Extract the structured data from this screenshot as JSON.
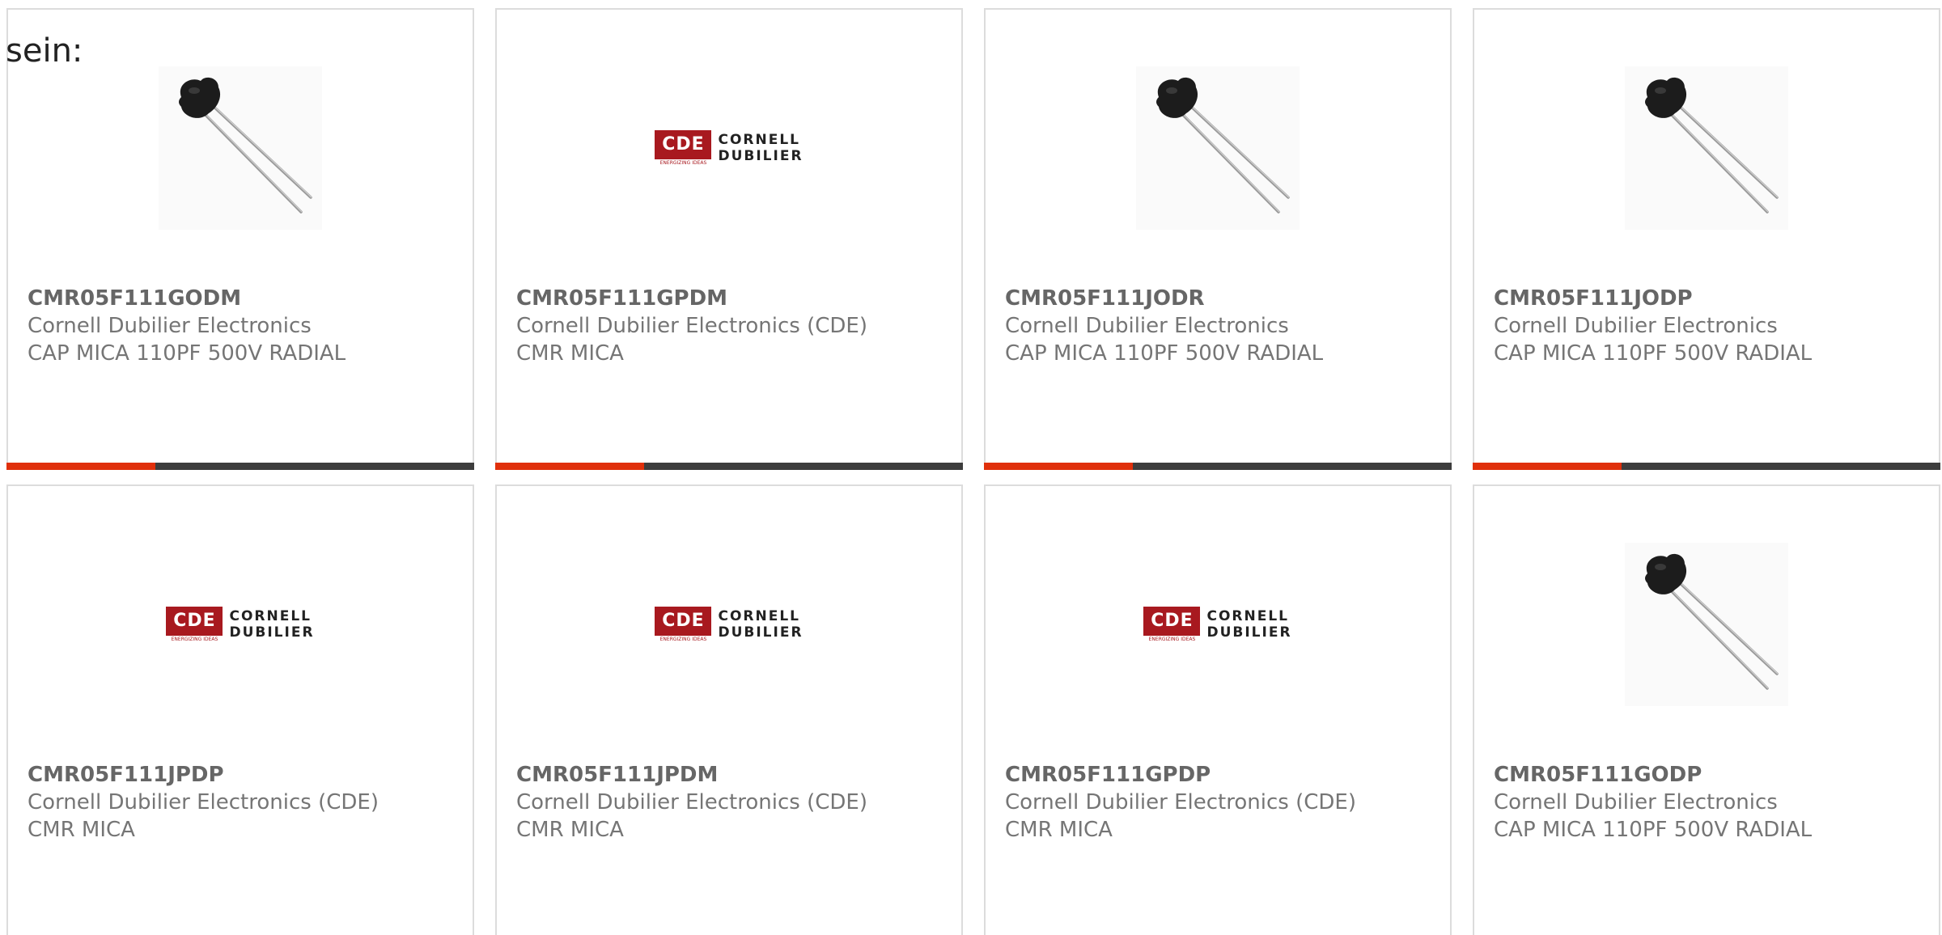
{
  "intro_text": "sein:",
  "colors": {
    "accent_bar": "#e0300b",
    "dark_bar": "#3d3d3d",
    "cde_red": "#a8191f"
  },
  "cards": [
    {
      "part": "CMR05F111GODM",
      "manufacturer": "Cornell Dubilier Electronics",
      "description": "CAP MICA 110PF 500V RADIAL",
      "image": "capacitor-photo"
    },
    {
      "part": "CMR05F111GPDM",
      "manufacturer": "Cornell Dubilier Electronics (CDE)",
      "description": "CMR MICA",
      "image": "cde-logo"
    },
    {
      "part": "CMR05F111JODR",
      "manufacturer": "Cornell Dubilier Electronics",
      "description": "CAP MICA 110PF 500V RADIAL",
      "image": "capacitor-photo"
    },
    {
      "part": "CMR05F111JODP",
      "manufacturer": "Cornell Dubilier Electronics",
      "description": "CAP MICA 110PF 500V RADIAL",
      "image": "capacitor-photo"
    },
    {
      "part": "CMR05F111JPDP",
      "manufacturer": "Cornell Dubilier Electronics (CDE)",
      "description": "CMR MICA",
      "image": "cde-logo"
    },
    {
      "part": "CMR05F111JPDM",
      "manufacturer": "Cornell Dubilier Electronics (CDE)",
      "description": "CMR MICA",
      "image": "cde-logo"
    },
    {
      "part": "CMR05F111GPDP",
      "manufacturer": "Cornell Dubilier Electronics (CDE)",
      "description": "CMR MICA",
      "image": "cde-logo"
    },
    {
      "part": "CMR05F111GODP",
      "manufacturer": "Cornell Dubilier Electronics",
      "description": "CAP MICA 110PF 500V RADIAL",
      "image": "capacitor-photo"
    }
  ],
  "logo": {
    "mark": "CDE",
    "line1": "CORNELL",
    "line2": "DUBILIER",
    "tagline": "ENERGIZING IDEAS"
  }
}
